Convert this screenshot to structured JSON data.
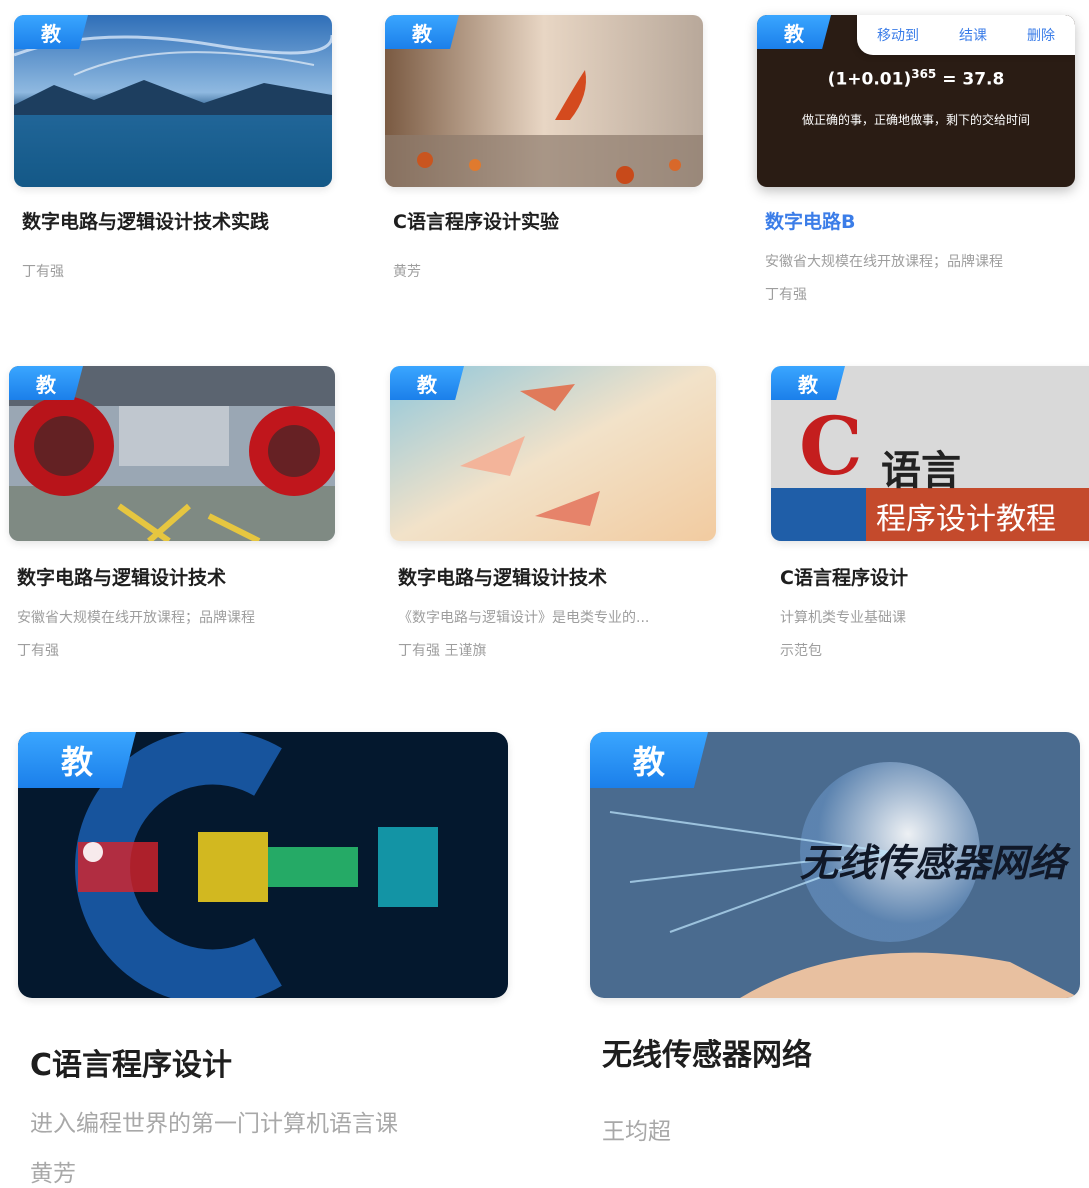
{
  "badge_label": "教",
  "accent_color": "#3b7de8",
  "menu": {
    "move": "移动到",
    "finish": "结课",
    "delete": "删除"
  },
  "formula": {
    "base": "(1+0.01)",
    "exp": "365",
    "result": "= 37.8",
    "motto": "做正确的事，正确地做事，剩下的交给时间"
  },
  "images": {
    "c_book_big": "C",
    "c_book_text": "语言",
    "c_book_sub": "程序设计教程",
    "wsn_text": "无线传感器网络"
  },
  "courses": [
    {
      "title": "数字电路与逻辑设计技术实践",
      "lines": [
        "丁有强"
      ]
    },
    {
      "title": "C语言程序设计实验",
      "lines": [
        "黄芳"
      ]
    },
    {
      "title": "数字电路B",
      "lines": [
        "安徽省大规模在线开放课程；品牌课程",
        "丁有强"
      ]
    },
    {
      "title": "数字电路与逻辑设计技术",
      "lines": [
        "安徽省大规模在线开放课程；品牌课程",
        "丁有强"
      ]
    },
    {
      "title": "数字电路与逻辑设计技术",
      "lines": [
        "《数字电路与逻辑设计》是电类专业的...",
        "丁有强 王谨旗"
      ]
    },
    {
      "title": "C语言程序设计",
      "lines": [
        "计算机类专业基础课",
        "示范包"
      ]
    },
    {
      "title": "C语言程序设计",
      "lines": [
        "进入编程世界的第一门计算机语言课",
        "黄芳"
      ]
    },
    {
      "title": "无线传感器网络",
      "lines": [
        "王均超"
      ]
    }
  ]
}
